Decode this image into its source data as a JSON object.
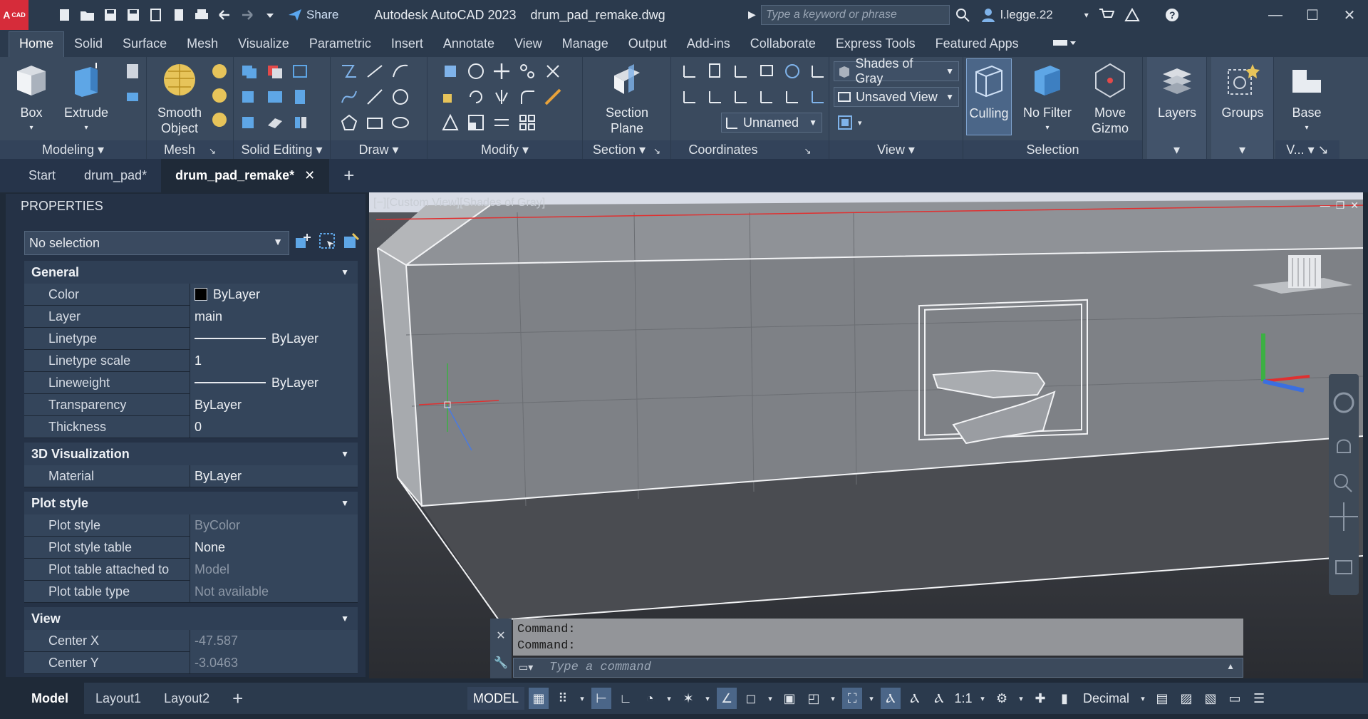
{
  "titlebar": {
    "logo_main": "A",
    "logo_sub": "CAD",
    "share_label": "Share",
    "app_title": "Autodesk AutoCAD 2023",
    "file_title": "drum_pad_remake.dwg",
    "search_placeholder": "Type a keyword or phrase",
    "user_name": "l.legge.22"
  },
  "ribbon_tabs": [
    "Home",
    "Solid",
    "Surface",
    "Mesh",
    "Visualize",
    "Parametric",
    "Insert",
    "Annotate",
    "View",
    "Manage",
    "Output",
    "Add-ins",
    "Collaborate",
    "Express Tools",
    "Featured Apps"
  ],
  "ribbon": {
    "modeling": {
      "label": "Modeling",
      "box": "Box",
      "extrude": "Extrude"
    },
    "mesh": {
      "label": "Mesh",
      "smooth_object": "Smooth Object"
    },
    "solid_editing": {
      "label": "Solid Editing"
    },
    "draw": {
      "label": "Draw"
    },
    "modify": {
      "label": "Modify"
    },
    "section": {
      "label": "Section",
      "section_plane": "Section Plane"
    },
    "coordinates": {
      "label": "Coordinates",
      "ucs_name": "Unnamed"
    },
    "view": {
      "label": "View",
      "visual_style": "Shades of Gray",
      "named_view": "Unsaved View"
    },
    "selection": {
      "label": "Selection",
      "culling": "Culling",
      "no_filter": "No Filter",
      "move_gizmo": "Move Gizmo"
    },
    "layers": {
      "label": "Layers"
    },
    "groups": {
      "label": "Groups"
    },
    "base": {
      "label": "Base",
      "panel_label": "V..."
    }
  },
  "doc_tabs": {
    "start": "Start",
    "tab1": "drum_pad*",
    "tab2": "drum_pad_remake*"
  },
  "properties": {
    "title": "PROPERTIES",
    "selection": "No selection",
    "sections": {
      "general": "General",
      "vis3d": "3D Visualization",
      "plotstyle": "Plot style",
      "view": "View"
    },
    "general": [
      {
        "k": "Color",
        "v": "ByLayer"
      },
      {
        "k": "Layer",
        "v": "main"
      },
      {
        "k": "Linetype",
        "v": "ByLayer"
      },
      {
        "k": "Linetype scale",
        "v": "1"
      },
      {
        "k": "Lineweight",
        "v": "ByLayer"
      },
      {
        "k": "Transparency",
        "v": "ByLayer"
      },
      {
        "k": "Thickness",
        "v": "0"
      }
    ],
    "vis3d": [
      {
        "k": "Material",
        "v": "ByLayer"
      }
    ],
    "plotstyle": [
      {
        "k": "Plot style",
        "v": "ByColor"
      },
      {
        "k": "Plot style table",
        "v": "None"
      },
      {
        "k": "Plot table attached to",
        "v": "Model"
      },
      {
        "k": "Plot table type",
        "v": "Not available"
      }
    ],
    "view": [
      {
        "k": "Center X",
        "v": "-47.587"
      },
      {
        "k": "Center Y",
        "v": "-3.0463"
      }
    ]
  },
  "viewport": {
    "label": "[−][Custom View][Shades of Gray]"
  },
  "command": {
    "history": [
      "Command:",
      "Command:"
    ],
    "placeholder": "Type a command"
  },
  "statusbar": {
    "layouts": [
      "Model",
      "Layout1",
      "Layout2"
    ],
    "model_label": "MODEL",
    "scale": "1:1",
    "units": "Decimal"
  }
}
